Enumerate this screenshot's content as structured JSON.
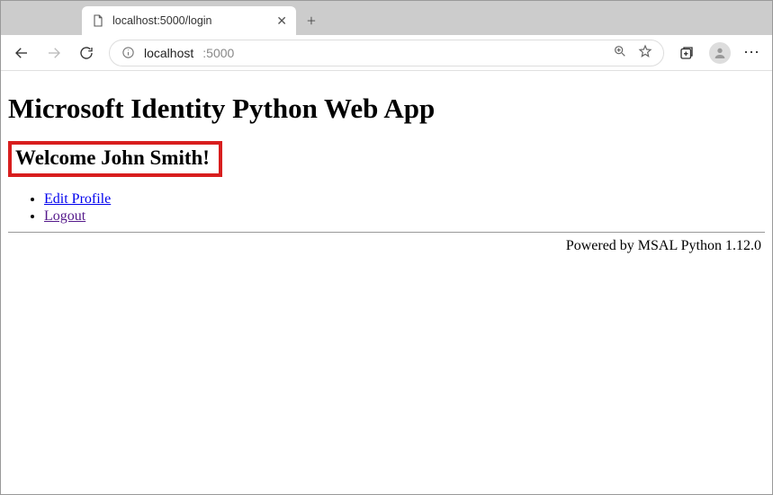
{
  "browser": {
    "tab_title": "localhost:5000/login",
    "url_host": "localhost",
    "url_port": ":5000"
  },
  "page": {
    "heading": "Microsoft Identity Python Web App",
    "welcome": "Welcome John Smith!",
    "links": {
      "edit_profile": "Edit Profile",
      "logout": "Logout"
    },
    "footer": "Powered by MSAL Python 1.12.0"
  }
}
